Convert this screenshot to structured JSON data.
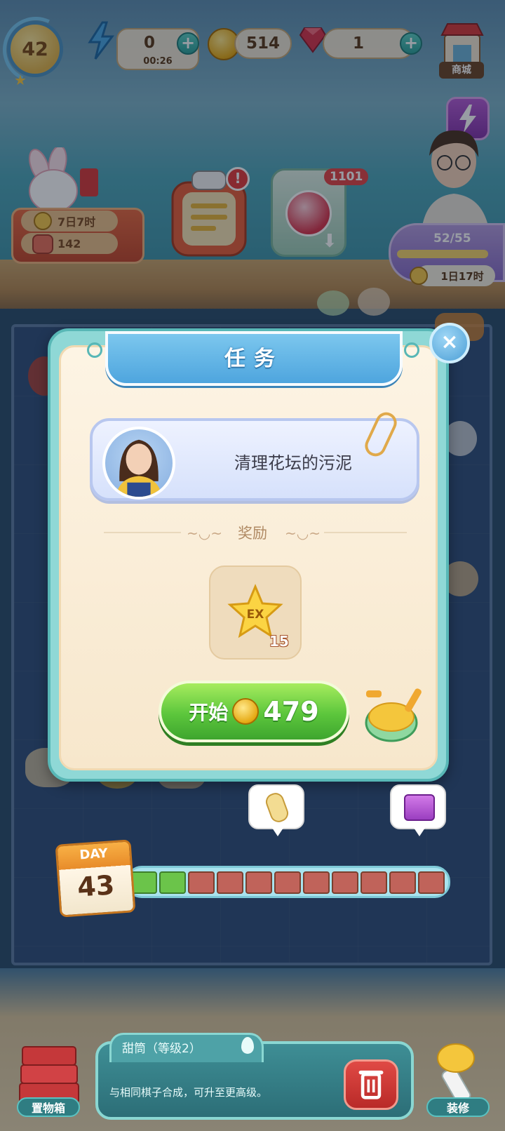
{
  "hud": {
    "player_level": "42",
    "energy": {
      "value": "0",
      "timer": "00:26"
    },
    "coins": {
      "value": "514"
    },
    "gems": {
      "value": "1"
    },
    "shop_label": "商城"
  },
  "events": {
    "bunny_event": {
      "time_left": "7日7时",
      "points": "142"
    },
    "task_alert_badge": "!",
    "orb_count": "1101",
    "season": {
      "progress": "52/55",
      "time_left": "1日17时"
    }
  },
  "task_dialog": {
    "title": "任务",
    "close_symbol": "×",
    "task_description": "清理花坛的污泥",
    "reward_heading": "奖励",
    "reward": {
      "icon": "ex-star-icon",
      "badge": "EX",
      "quantity": "15"
    },
    "start_button": {
      "label": "开始",
      "cost": "479"
    }
  },
  "day_progress": {
    "day_label": "DAY",
    "day_number": "43",
    "segments_total": 11,
    "segments_filled": 2
  },
  "bottom_bar": {
    "storage_label": "置物箱",
    "item_info": {
      "title": "甜筒（等级2）",
      "description": "与相同棋子合成，可升至更高级。"
    },
    "decorate_label": "装修"
  },
  "colors": {
    "accent_green": "#5cc63c",
    "banner_blue": "#4ea5de",
    "modal_teal": "#8fd8d6",
    "segment_filled": "#6bc44a",
    "segment_empty": "#c0635a"
  }
}
